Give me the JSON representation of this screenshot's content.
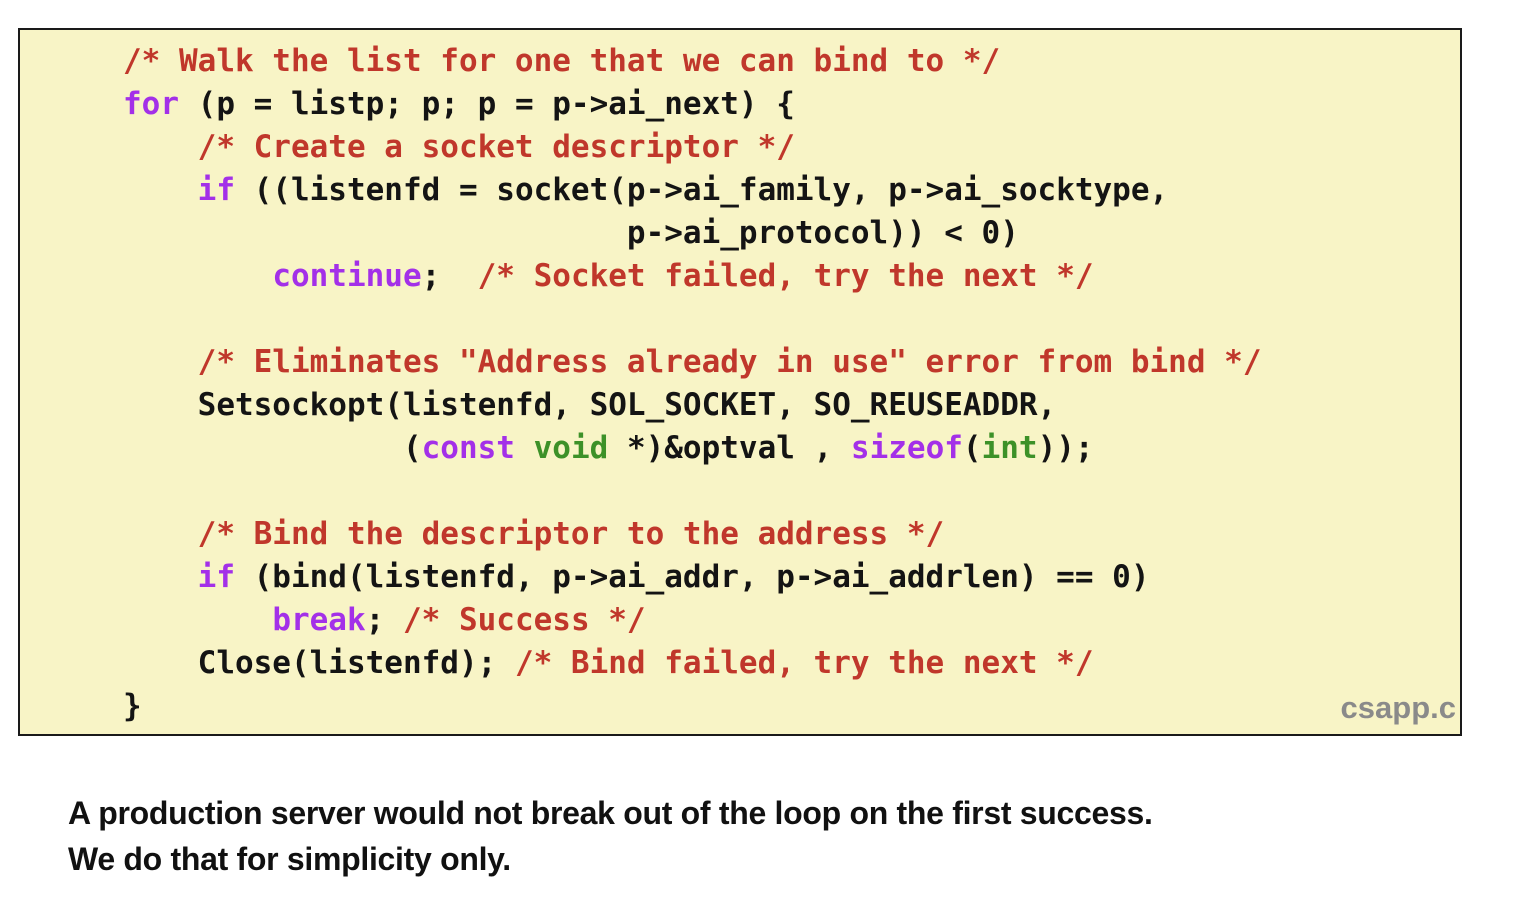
{
  "code_listing": {
    "lines": [
      [
        {
          "c": "comment",
          "t": "/* Walk the list for one that we can bind to */"
        }
      ],
      [
        {
          "c": "keyword",
          "t": "for"
        },
        {
          "c": "plain",
          "t": " (p = listp; p; p = p->ai_next) {"
        }
      ],
      [
        {
          "c": "plain",
          "t": "    "
        },
        {
          "c": "comment",
          "t": "/* Create a socket descriptor */"
        }
      ],
      [
        {
          "c": "plain",
          "t": "    "
        },
        {
          "c": "keyword",
          "t": "if"
        },
        {
          "c": "plain",
          "t": " ((listenfd = socket(p->ai_family, p->ai_socktype,"
        }
      ],
      [
        {
          "c": "plain",
          "t": "                           p->ai_protocol)) < 0)"
        }
      ],
      [
        {
          "c": "plain",
          "t": "        "
        },
        {
          "c": "keyword",
          "t": "continue"
        },
        {
          "c": "plain",
          "t": ";  "
        },
        {
          "c": "comment",
          "t": "/* Socket failed, try the next */"
        }
      ],
      [
        {
          "c": "plain",
          "t": ""
        }
      ],
      [
        {
          "c": "plain",
          "t": "    "
        },
        {
          "c": "comment",
          "t": "/* Eliminates \"Address already in use\" error from bind */"
        }
      ],
      [
        {
          "c": "plain",
          "t": "    Setsockopt(listenfd, SOL_SOCKET, SO_REUSEADDR,"
        }
      ],
      [
        {
          "c": "plain",
          "t": "               ("
        },
        {
          "c": "keyword",
          "t": "const"
        },
        {
          "c": "plain",
          "t": " "
        },
        {
          "c": "type",
          "t": "void"
        },
        {
          "c": "plain",
          "t": " *)&optval , "
        },
        {
          "c": "keyword",
          "t": "sizeof"
        },
        {
          "c": "plain",
          "t": "("
        },
        {
          "c": "type",
          "t": "int"
        },
        {
          "c": "plain",
          "t": "));"
        }
      ],
      [
        {
          "c": "plain",
          "t": ""
        }
      ],
      [
        {
          "c": "plain",
          "t": "    "
        },
        {
          "c": "comment",
          "t": "/* Bind the descriptor to the address */"
        }
      ],
      [
        {
          "c": "plain",
          "t": "    "
        },
        {
          "c": "keyword",
          "t": "if"
        },
        {
          "c": "plain",
          "t": " (bind(listenfd, p->ai_addr, p->ai_addrlen) == 0)"
        }
      ],
      [
        {
          "c": "plain",
          "t": "        "
        },
        {
          "c": "keyword",
          "t": "break"
        },
        {
          "c": "plain",
          "t": "; "
        },
        {
          "c": "comment",
          "t": "/* Success */"
        }
      ],
      [
        {
          "c": "plain",
          "t": "    Close(listenfd); "
        },
        {
          "c": "comment",
          "t": "/* Bind failed, try the next */"
        }
      ],
      [
        {
          "c": "plain",
          "t": "}"
        }
      ]
    ],
    "file_label": "csapp.c"
  },
  "caption": {
    "line1": "A production server would not break out of the loop on the first success.",
    "line2": "We do that for simplicity only."
  },
  "colors": {
    "background": "#f8f4c6",
    "comment": "#c0372b",
    "keyword": "#a330e8",
    "type": "#3d9128",
    "text": "#141414",
    "file_label": "#8a8a8a"
  }
}
